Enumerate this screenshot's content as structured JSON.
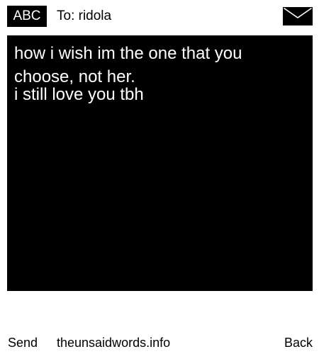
{
  "header": {
    "mode_label": "ABC",
    "recipient": "To: ridola",
    "envelope_icon": "envelope-icon"
  },
  "message": {
    "lines": [
      "how i wish im the one that you",
      "choose, not her.",
      "i still love you tbh"
    ]
  },
  "footer": {
    "send_label": "Send",
    "site_label": "theunsaidwords.info",
    "back_label": "Back"
  },
  "colors": {
    "background": "#ffffff",
    "message_background": "#000000",
    "message_text": "#ffffff",
    "text": "#000000"
  }
}
